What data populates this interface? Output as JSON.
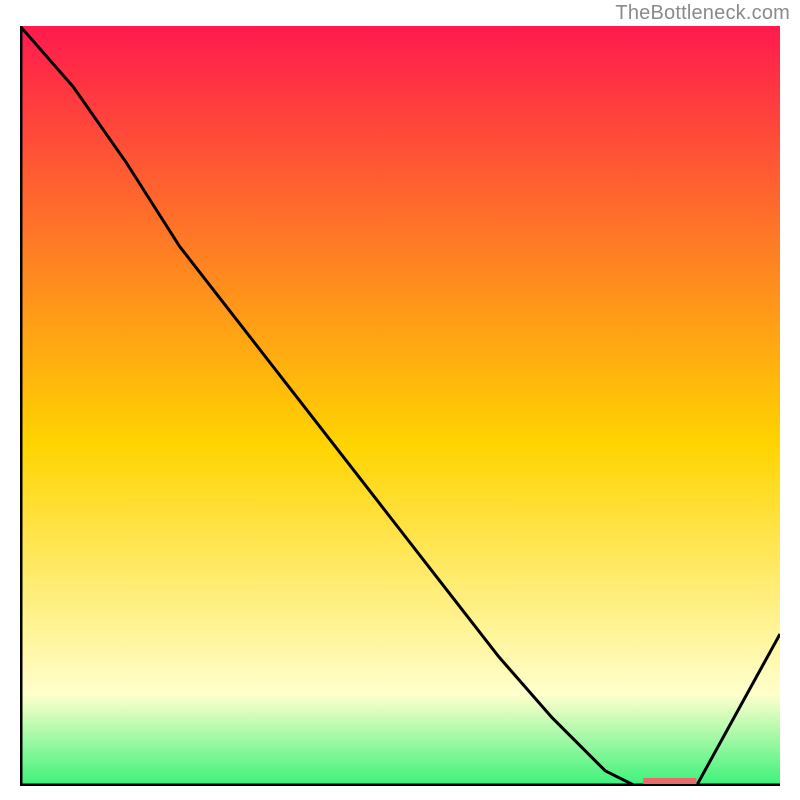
{
  "attribution": "TheBottleneck.com",
  "chart_data": {
    "type": "line",
    "background": "gradient-red-yellow-green",
    "series": [
      {
        "name": "curve",
        "x": [
          0.0,
          0.07,
          0.14,
          0.21,
          0.28,
          0.35,
          0.42,
          0.49,
          0.56,
          0.63,
          0.7,
          0.77,
          0.81,
          0.85,
          0.89,
          1.0
        ],
        "values": [
          1.0,
          0.92,
          0.82,
          0.71,
          0.62,
          0.53,
          0.44,
          0.35,
          0.26,
          0.17,
          0.09,
          0.02,
          0.0,
          0.0,
          0.0,
          0.2
        ]
      }
    ],
    "marker": {
      "x": 0.82,
      "width": 0.07
    },
    "xlabel": "",
    "ylabel": "",
    "xlim": [
      0,
      1
    ],
    "ylim": [
      0,
      1
    ],
    "axes_visible": "partial",
    "grid": false
  },
  "colors": {
    "curve": "#000000",
    "marker": "#e86a6a",
    "axis": "#000000",
    "gradient_top": "#ff1a4d",
    "gradient_mid": "#ffd400",
    "gradient_paleyellow": "#ffffcc",
    "gradient_green": "#3bf27a"
  }
}
